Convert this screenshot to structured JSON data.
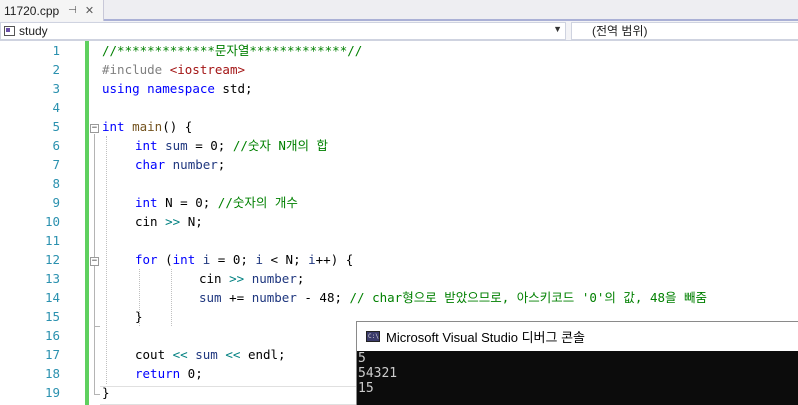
{
  "tab": {
    "filename": "11720.cpp",
    "pin_glyph": "⊣",
    "close_glyph": "✕"
  },
  "navbar": {
    "scope": "study",
    "member": "(전역 범위)"
  },
  "line_numbers": [
    "1",
    "2",
    "3",
    "4",
    "5",
    "6",
    "7",
    "8",
    "9",
    "10",
    "11",
    "12",
    "13",
    "14",
    "15",
    "16",
    "17",
    "18",
    "19"
  ],
  "code": {
    "l1": "//*************문자열*************//",
    "l2a": "#include ",
    "l2b": "<iostream>",
    "l3a": "using",
    "l3b": " ",
    "l3c": "namespace",
    "l3d": " std;",
    "l5a": "int",
    "l5b": " ",
    "l5c": "main",
    "l5d": "() {",
    "l6a": "int",
    "l6b": " ",
    "l6c": "sum",
    "l6d": " = 0; ",
    "l6e": "//숫자 N개의 합",
    "l7a": "char",
    "l7b": " ",
    "l7c": "number",
    "l7d": ";",
    "l9a": "int",
    "l9b": " N = 0; ",
    "l9c": "//숫자의 개수",
    "l10a": "cin",
    "l10b": " ",
    "l10c": ">>",
    "l10d": " N;",
    "l12a": "for",
    "l12b": " (",
    "l12c": "int",
    "l12d": " ",
    "l12e": "i",
    "l12f": " = 0; ",
    "l12g": "i",
    "l12h": " < N; ",
    "l12i": "i",
    "l12j": "++) {",
    "l13a": "cin",
    "l13b": " ",
    "l13c": ">>",
    "l13d": " ",
    "l13e": "number",
    "l13f": ";",
    "l14a": "sum",
    "l14b": " += ",
    "l14c": "number",
    "l14d": " - 48; ",
    "l14e": "// char형으로 받았으므로, 아스키코드 '0'의 값, 48을 빼줌",
    "l15": "}",
    "l17a": "cout",
    "l17b": " ",
    "l17c": "<<",
    "l17d": " ",
    "l17e": "sum",
    "l17f": " ",
    "l17g": "<<",
    "l17h": " ",
    "l17i": "endl",
    "l17j": ";",
    "l18a": "return",
    "l18b": " 0;",
    "l19": "}"
  },
  "console": {
    "icon_text": "C:\\",
    "title": "Microsoft Visual Studio 디버그 콘솔",
    "output": [
      "5",
      "54321",
      "15"
    ]
  }
}
